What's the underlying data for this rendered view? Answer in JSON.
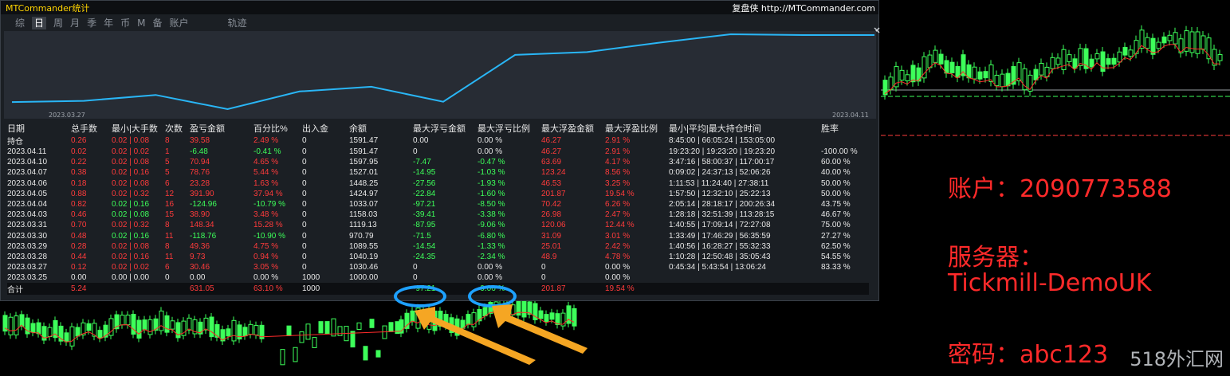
{
  "app_title": "MTCommander统计",
  "brand": "复盘侠 http://MTCommander.com",
  "tabs": [
    {
      "label": "综",
      "active": false
    },
    {
      "label": "日",
      "active": true
    },
    {
      "label": "周",
      "active": false
    },
    {
      "label": "月",
      "active": false
    },
    {
      "label": "季",
      "active": false
    },
    {
      "label": "年",
      "active": false
    },
    {
      "label": "币",
      "active": false
    },
    {
      "label": "M",
      "active": false
    },
    {
      "label": "备",
      "active": false
    },
    {
      "label": "账户",
      "active": false
    },
    {
      "label": "轨迹",
      "active": false
    }
  ],
  "equity_chart": {
    "start_label": "2023.03.27",
    "end_label": "2023.04.11",
    "values": [
      1030.46,
      1040.19,
      1089.55,
      970.79,
      1119.13,
      1158.03,
      1033.07,
      1424.97,
      1448.25,
      1527.01,
      1597.95,
      1591.47,
      1591.47
    ],
    "line_color": "#29b6f6"
  },
  "table": {
    "headers": [
      "日期",
      "总手数",
      "最小|大手数",
      "次数",
      "盈亏金额",
      "百分比%",
      "出入金",
      "余额",
      "最大浮亏金额",
      "最大浮亏比例",
      "最大浮盈金额",
      "最大浮盈比例",
      "最小|平均|最大持仓时间",
      "胜率"
    ],
    "rows": [
      [
        "持仓",
        "0.26",
        "0.02 | 0.08",
        "8",
        "39.58",
        "2.49 %",
        "0",
        "1591.47",
        "0.00",
        "0.00 %",
        "46.27",
        "2.91 %",
        "8:45:00 | 66:05:24 | 153:05:00",
        ""
      ],
      [
        "2023.04.11",
        "0.02",
        "0.02 | 0.02",
        "1",
        "-6.48",
        "-0.41 %",
        "0",
        "1591.47",
        "0",
        "0.00 %",
        "46.27",
        "2.91 %",
        "19:23:20 | 19:23:20 | 19:23:20",
        "-100.00 %"
      ],
      [
        "2023.04.10",
        "0.22",
        "0.02 | 0.08",
        "5",
        "70.94",
        "4.65 %",
        "0",
        "1597.95",
        "-7.47",
        "-0.47 %",
        "63.69",
        "4.17 %",
        "3:47:16 | 58:00:37 | 117:00:17",
        "60.00 %"
      ],
      [
        "2023.04.07",
        "0.38",
        "0.02 | 0.16",
        "5",
        "78.76",
        "5.44 %",
        "0",
        "1527.01",
        "-14.95",
        "-1.03 %",
        "123.24",
        "8.56 %",
        "0:09:02 | 24:37:13 | 52:06:26",
        "40.00 %"
      ],
      [
        "2023.04.06",
        "0.18",
        "0.02 | 0.08",
        "6",
        "23.28",
        "1.63 %",
        "0",
        "1448.25",
        "-27.56",
        "-1.93 %",
        "46.53",
        "3.25 %",
        "1:11:53 | 11:24:40 | 27:38:11",
        "50.00 %"
      ],
      [
        "2023.04.05",
        "0.88",
        "0.02 | 0.32",
        "12",
        "391.90",
        "37.94 %",
        "0",
        "1424.97",
        "-22.84",
        "-1.60 %",
        "201.87",
        "19.54 %",
        "1:57:50 | 12:32:10 | 25:22:13",
        "50.00 %"
      ],
      [
        "2023.04.04",
        "0.82",
        "0.02 | 0.16",
        "16",
        "-124.96",
        "-10.79 %",
        "0",
        "1033.07",
        "-97.21",
        "-8.50 %",
        "70.42",
        "6.26 %",
        "2:05:14 | 28:18:17 | 200:26:34",
        "43.75 %"
      ],
      [
        "2023.04.03",
        "0.46",
        "0.02 | 0.08",
        "15",
        "38.90",
        "3.48 %",
        "0",
        "1158.03",
        "-39.41",
        "-3.38 %",
        "26.98",
        "2.47 %",
        "1:28:18 | 32:51:39 | 113:28:15",
        "46.67 %"
      ],
      [
        "2023.03.31",
        "0.70",
        "0.02 | 0.32",
        "8",
        "148.34",
        "15.28 %",
        "0",
        "1119.13",
        "-87.95",
        "-9.06 %",
        "120.06",
        "12.44 %",
        "1:40:55 | 17:09:14 | 72:27:08",
        "75.00 %"
      ],
      [
        "2023.03.30",
        "0.48",
        "0.02 | 0.16",
        "11",
        "-118.76",
        "-10.90 %",
        "0",
        "970.79",
        "-71.5",
        "-6.80 %",
        "31.09",
        "3.01 %",
        "1:33:49 | 17:46:29 | 56:35:59",
        "27.27 %"
      ],
      [
        "2023.03.29",
        "0.28",
        "0.02 | 0.08",
        "8",
        "49.36",
        "4.75 %",
        "0",
        "1089.55",
        "-14.54",
        "-1.33 %",
        "25.01",
        "2.42 %",
        "1:40:56 | 16:28:27 | 55:32:33",
        "62.50 %"
      ],
      [
        "2023.03.28",
        "0.44",
        "0.02 | 0.16",
        "11",
        "9.73",
        "0.94 %",
        "0",
        "1040.19",
        "-24.35",
        "-2.34 %",
        "48.9",
        "4.78 %",
        "1:10:28 | 12:50:48 | 35:05:43",
        "54.55 %"
      ],
      [
        "2023.03.27",
        "0.12",
        "0.02 | 0.02",
        "6",
        "30.46",
        "3.05 %",
        "0",
        "1030.46",
        "0",
        "0.00 %",
        "0",
        "0.00 %",
        "0:45:34 | 5:43:54 | 13:06:24",
        "83.33 %"
      ],
      [
        "2023.03.25",
        "0.00",
        "0.00 | 0.00",
        "0",
        "0.00",
        "0.00 %",
        "1000",
        "1000.00",
        "0",
        "0.00 %",
        "0",
        "0.00 %",
        "",
        ""
      ]
    ],
    "total": [
      "合计",
      "5.24",
      "",
      "",
      "631.05",
      "63.10 %",
      "1000",
      "",
      "-97.21",
      "-9.06 %",
      "201.87",
      "19.54 %",
      "",
      ""
    ]
  },
  "overlay": {
    "account_line": "账户：2090773588",
    "server_label": "服务器：",
    "server_value": "Tickmill-DemoUK",
    "password_line": "密码：abc123",
    "watermark": "518外汇网"
  },
  "colors": {
    "positive": "#3dff5a",
    "negative": "#ff3b3b",
    "accent_ring": "#1ea1ff",
    "arrow": "#f5a623"
  }
}
